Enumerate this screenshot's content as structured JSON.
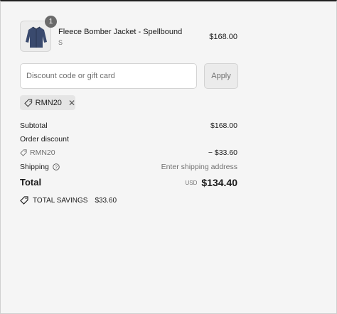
{
  "cart": {
    "item": {
      "quantity": "1",
      "name": "Fleece Bomber Jacket - Spellbound",
      "variant": "S",
      "price": "$168.00"
    }
  },
  "discount": {
    "placeholder": "Discount code or gift card",
    "apply_label": "Apply",
    "applied_code": "RMN20"
  },
  "summary": {
    "subtotal_label": "Subtotal",
    "subtotal_value": "$168.00",
    "order_discount_label": "Order discount",
    "discount_code": "RMN20",
    "discount_value": "− $33.60",
    "shipping_label": "Shipping",
    "shipping_value": "Enter shipping address",
    "total_label": "Total",
    "currency": "USD",
    "total_value": "$134.40",
    "savings_label": "TOTAL SAVINGS",
    "savings_value": "$33.60"
  }
}
